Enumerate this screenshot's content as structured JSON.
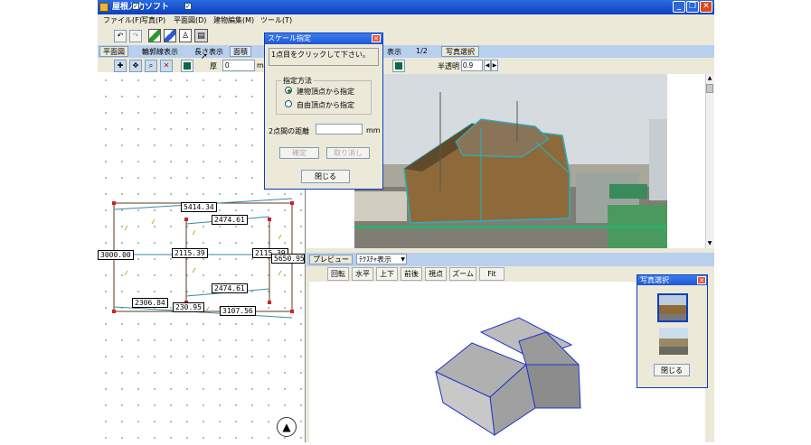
{
  "window": {
    "title": "屋根入力ソフト",
    "minimize": "_",
    "restore": "❐",
    "close": "✕"
  },
  "menu": [
    "ファイル(F)",
    "写真(P)",
    "平面図(D)",
    "建物編集(M)",
    "ツール(T)"
  ],
  "toolbar2": {
    "plan_tab": "平面図",
    "outline_label": "輪郭線表示",
    "length_label": "長さ表示",
    "area_label": "面積",
    "hyouji_label": "表示",
    "page": "1/2",
    "photo_select_btn": "写真選択"
  },
  "toolbar3": {
    "thickness_label": "厚",
    "thickness_value": "0",
    "thickness_unit": "mm",
    "transparency_label": "半透明",
    "transparency_value": "0.9"
  },
  "scale_dialog": {
    "title": "スケール指定",
    "instruction": "1点目をクリックして下さい。",
    "method_group": "指定方法",
    "option_building": "建物頂点から指定",
    "option_free": "自由頂点から指定",
    "distance_label": "2点間の距離",
    "distance_value": "",
    "distance_unit": "mm",
    "confirm_btn": "確定",
    "cancel_btn": "取り消し",
    "close_btn": "閉じる"
  },
  "plan_dims": {
    "top": "5414.34",
    "inner_top": "2474.61",
    "left": "3000.00",
    "middle": "2115.39",
    "right": "2115.39",
    "right_edge": "5650.95",
    "inner_bottom": "2474.61",
    "bottom_left": "2306.84",
    "bottom_mid": "230.95",
    "bottom_right": "3107.56"
  },
  "preview": {
    "label": "プレビュー",
    "texture_select": "ﾃｸｽﾁｬ表示",
    "buttons": [
      "回転",
      "水平",
      "上下",
      "前後",
      "視点",
      "ズーム",
      "Fit"
    ]
  },
  "photo_select": {
    "title": "写真選択",
    "close_btn": "閉じる"
  }
}
